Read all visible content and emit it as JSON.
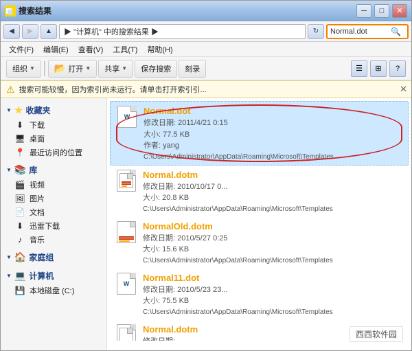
{
  "window": {
    "title": "搜索结果",
    "controls": {
      "minimize": "─",
      "maximize": "□",
      "close": "✕"
    }
  },
  "address": {
    "path": "▶  \"计算机\" 中的搜索结果  ▶",
    "search_value": "Normal.dot"
  },
  "menu": {
    "items": [
      "文件(F)",
      "编辑(E)",
      "查看(V)",
      "工具(T)",
      "帮助(H)"
    ]
  },
  "toolbar": {
    "organize": "组织",
    "open": "打开",
    "share": "共享",
    "save_search": "保存搜索",
    "burn": "刻录"
  },
  "warning": {
    "text": "搜索可能较慢，因为索引尚未运行。请单击打开索引引...",
    "close": "✕"
  },
  "sidebar": {
    "sections": [
      {
        "label": "收藏夹",
        "items": [
          {
            "icon": "⬇",
            "label": "下载"
          },
          {
            "icon": "🖥",
            "label": "桌面"
          },
          {
            "icon": "📍",
            "label": "最近访问的位置"
          }
        ]
      },
      {
        "label": "库",
        "items": [
          {
            "icon": "🎬",
            "label": "视频"
          },
          {
            "icon": "🖼",
            "label": "图片"
          },
          {
            "icon": "📄",
            "label": "文档"
          },
          {
            "icon": "⬇",
            "label": "迅雷下载"
          },
          {
            "icon": "♪",
            "label": "音乐"
          }
        ]
      },
      {
        "label": "家庭组",
        "items": []
      },
      {
        "label": "计算机",
        "items": [
          {
            "icon": "💾",
            "label": "本地磁盘 (C:)"
          }
        ]
      }
    ]
  },
  "files": [
    {
      "name": "Normal.dot",
      "meta_line1": "修改日期: 2011/4/21 0:15",
      "meta_line2": "大小: 77.5 KB",
      "meta_line3": "作者: yang",
      "path": "C:\\Users\\Administrator\\AppData\\Roaming\\Microsoft\\Templates",
      "selected": true,
      "has_oval": true
    },
    {
      "name": "Normal.dotm",
      "meta_line1": "修改日期: 2010/10/17 0...",
      "meta_line2": "大小: 20.8 KB",
      "meta_line3": "",
      "path": "C:\\Users\\Administrator\\AppData\\Roaming\\Microsoft\\Templates",
      "selected": false,
      "has_oval": false
    },
    {
      "name": "NormalOld.dotm",
      "meta_line1": "修改日期: 2010/5/27 0:25",
      "meta_line2": "大小: 15.6 KB",
      "meta_line3": "",
      "path": "C:\\Users\\Administrator\\AppData\\Roaming\\Microsoft\\Templates",
      "selected": false,
      "has_oval": false
    },
    {
      "name": "Normal11.dot",
      "meta_line1": "修改日期: 2010/5/23 23...",
      "meta_line2": "大小: 75.5 KB",
      "meta_line3": "",
      "path": "C:\\Users\\Administrator\\AppData\\Roaming\\Microsoft\\Templates",
      "selected": false,
      "has_oval": false
    },
    {
      "name": "Normal.dotm",
      "meta_line1": "修改日期:",
      "meta_line2": "",
      "meta_line3": "",
      "path": "",
      "selected": false,
      "has_oval": false,
      "partial": true
    }
  ],
  "watermark": "西西软件园"
}
